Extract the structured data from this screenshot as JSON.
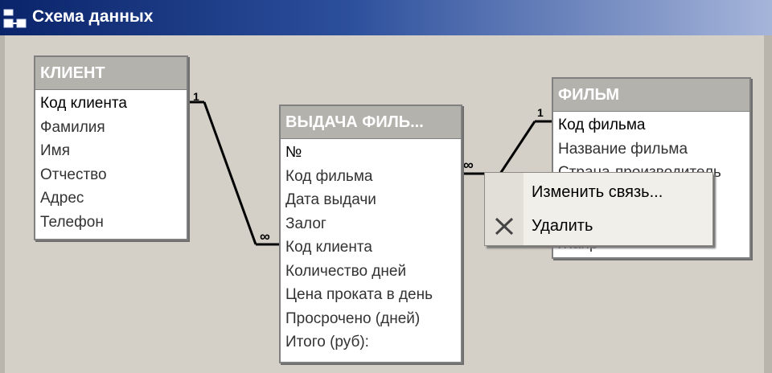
{
  "window": {
    "title": "Схема данных"
  },
  "tables": {
    "klient": {
      "title": "КЛИЕНТ",
      "fields": [
        "Код клиента",
        "Фамилия",
        "Имя",
        "Отчество",
        "Адрес",
        "Телефон"
      ]
    },
    "vydacha": {
      "title": "ВЫДАЧА ФИЛЬ...",
      "fields": [
        "№",
        "Код фильма",
        "Дата выдачи",
        "Залог",
        "Код клиента",
        "Количество дней",
        "Цена проката в день",
        "Просрочено (дней)",
        "Итого (руб):"
      ]
    },
    "film": {
      "title": "ФИЛЬМ",
      "fields": [
        "Код фильма",
        "Название фильма",
        "Страна-производитель",
        "",
        "",
        "Жанр"
      ]
    }
  },
  "relations": {
    "klient_vydacha": {
      "one": "1",
      "many": "∞"
    },
    "film_vydacha": {
      "one": "1",
      "many": "∞"
    }
  },
  "context_menu": {
    "edit_label": "Изменить связь...",
    "delete_label": "Удалить"
  }
}
